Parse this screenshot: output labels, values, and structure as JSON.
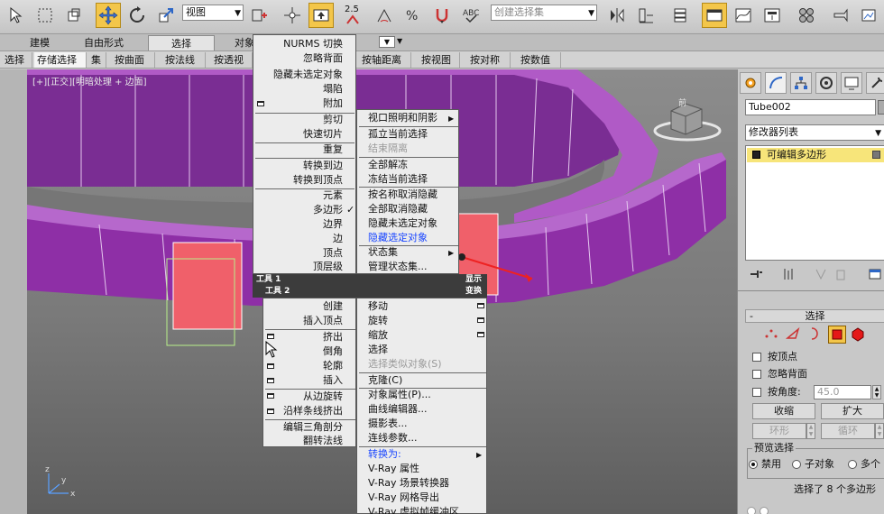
{
  "toolbar": {
    "view_dropdown": "视图",
    "spinner_value": "2.5",
    "selection_set_placeholder": "创建选择集"
  },
  "ribbon": {
    "tabs": [
      "建模",
      "自由形式",
      "选择",
      "对象"
    ]
  },
  "subtools": {
    "left": [
      "选择",
      "存储选择",
      "集",
      "按曲面",
      "按法线",
      "按透视"
    ],
    "right": [
      "按轴距离",
      "按视图",
      "按对称",
      "按数值"
    ]
  },
  "viewport": {
    "label": "[+][正交][明暗处理 + 边面]",
    "viewcube_label": "前"
  },
  "quad_menu_left": {
    "top_items": [
      "NURMS 切换",
      "忽略背面",
      "隐藏未选定对象",
      "塌陷",
      "附加",
      "剪切",
      "快速切片",
      "重复",
      "转换到边",
      "转换到顶点",
      "元素",
      "多边形",
      "边界",
      "边",
      "顶点",
      "顶层级"
    ],
    "checked_item": "✓",
    "bar1_left": "工具 1",
    "bar1_right": "显示",
    "bar2_left": "工具 2",
    "bar2_right": "变换",
    "bottom_items": [
      "创建",
      "插入顶点",
      "挤出",
      "倒角",
      "轮廓",
      "插入",
      "从边旋转",
      "沿样条线挤出",
      "编辑三角剖分",
      "翻转法线"
    ]
  },
  "quad_menu_right": {
    "top_items": [
      "视口照明和阴影",
      "孤立当前选择",
      "结束隔离",
      "全部解冻",
      "冻结当前选择",
      "按名称取消隐藏",
      "全部取消隐藏",
      "隐藏未选定对象",
      "隐藏选定对象",
      "状态集",
      "管理状态集..."
    ],
    "bottom_items": [
      "移动",
      "旋转",
      "缩放",
      "选择",
      "选择类似对象(S)",
      "克隆(C)",
      "对象属性(P)...",
      "曲线编辑器...",
      "摄影表...",
      "连线参数...",
      "转换为:",
      "V-Ray 属性",
      "V-Ray 场景转换器",
      "V-Ray 网格导出",
      "V-Ray 虚拟帧缓冲区"
    ]
  },
  "command_panel": {
    "object_name": "Tube002",
    "modifier_list": "修改器列表",
    "stack_item": "可编辑多边形",
    "rollout_select": "选择",
    "rollout_toggle": "-",
    "cb_vertex": "按顶点",
    "cb_backface": "忽略背面",
    "cb_angle": "按角度:",
    "angle_value": "45.0",
    "btn_shrink": "收缩",
    "btn_grow": "扩大",
    "btn_ring": "环形",
    "btn_loop": "循环",
    "preview_title": "预览选择",
    "radio_disabled": "禁用",
    "radio_subobject": "子对象",
    "radio_multi": "多个",
    "status": "选择了 8 个多边形"
  },
  "colors": {
    "accent_active": "#f3c64a",
    "mesh_purple": "#8e2fa6",
    "selected_face": "#f0606a",
    "hidden_selected_text": "#1a46ff"
  }
}
